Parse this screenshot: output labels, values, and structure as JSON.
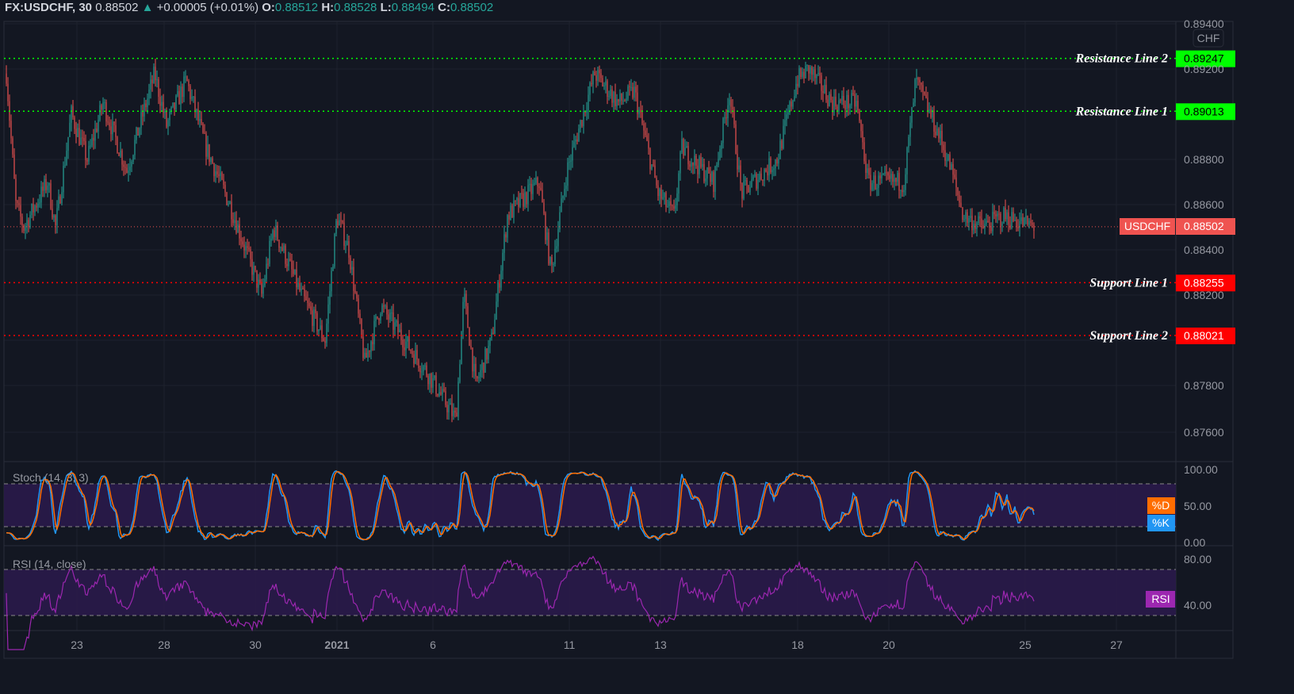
{
  "header": {
    "symbol": "FX:USDCHF, 30",
    "last": "0.88502",
    "change": "+0.00005 (+0.01%)",
    "o_label": "O:",
    "o": "0.88512",
    "h_label": "H:",
    "h": "0.88528",
    "l_label": "L:",
    "l": "0.88494",
    "c_label": "C:",
    "c": "0.88502",
    "direction_icon": "triangle-up-icon"
  },
  "currency_label": "CHF",
  "price_axis": [
    "0.89400",
    "0.89200",
    "0.88800",
    "0.88600",
    "0.88400",
    "0.88200",
    "0.87800",
    "0.87600"
  ],
  "time_axis": [
    "23",
    "28",
    "30",
    "2021",
    "6",
    "11",
    "13",
    "18",
    "20",
    "25",
    "27"
  ],
  "levels": [
    {
      "label": "Resistance Line 2",
      "value": "0.89247",
      "color": "#00ff00"
    },
    {
      "label": "Resistance Line 1",
      "value": "0.89013",
      "color": "#00ff00"
    },
    {
      "label": "Support Line 1",
      "value": "0.88255",
      "color": "#ff0000"
    },
    {
      "label": "Support Line 2",
      "value": "0.88021",
      "color": "#ff0000"
    }
  ],
  "last_price_tag": {
    "symbol": "USDCHF",
    "value": "0.88502",
    "color": "#ef5350"
  },
  "colors": {
    "up": "#26a69a",
    "down": "#ef5350",
    "background": "#131722",
    "k": "#2196f3",
    "d": "#ff6d00",
    "rsi": "#9c27b0"
  },
  "stoch": {
    "title": "Stoch (14, 3, 3)",
    "axis": [
      "100.00",
      "50.00",
      "0.00"
    ],
    "d_label": "%D",
    "k_label": "%K",
    "upper": 80,
    "lower": 20
  },
  "rsi": {
    "title": "RSI (14, close)",
    "axis": [
      "80.00",
      "40.00"
    ],
    "label": "RSI",
    "upper": 70,
    "lower": 30
  }
}
